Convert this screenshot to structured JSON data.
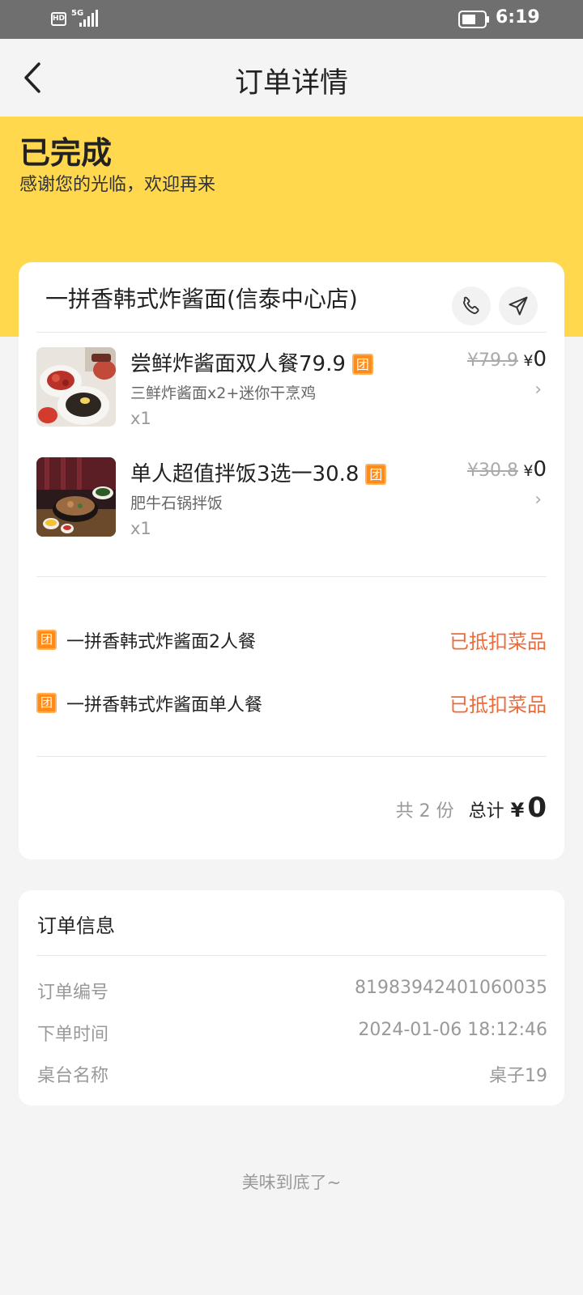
{
  "status_bar": {
    "network_badge": "HD",
    "network_type": "5G",
    "time": "6:19",
    "icons": [
      "hd-icon",
      "signal-icon",
      "battery-icon"
    ]
  },
  "nav": {
    "back_icon": "chevron-left-icon",
    "title": "订单详情"
  },
  "status": {
    "title": "已完成",
    "subtitle": "感谢您的光临，欢迎再来"
  },
  "store": {
    "name": "一拼香韩式炸酱面(信泰中心店)",
    "actions": [
      "phone-icon",
      "navigation-icon"
    ]
  },
  "items": [
    {
      "name": "尝鲜炸酱面双人餐79.9",
      "badge": "团",
      "desc": "三鲜炸酱面x2+迷你干烹鸡",
      "qty": "x1",
      "original_price": "¥79.9",
      "currency": "¥",
      "price": "0"
    },
    {
      "name": "单人超值拌饭3选一30.8",
      "badge": "团",
      "desc": "肥牛石锅拌饭",
      "qty": "x1",
      "original_price": "¥30.8",
      "currency": "¥",
      "price": "0"
    }
  ],
  "vouchers": [
    {
      "badge": "团",
      "label": "一拼香韩式炸酱面2人餐",
      "status": "已抵扣菜品"
    },
    {
      "badge": "团",
      "label": "一拼香韩式炸酱面单人餐",
      "status": "已抵扣菜品"
    }
  ],
  "summary": {
    "count": "共 2 份",
    "total_label": "总计",
    "currency": "¥",
    "total": "0"
  },
  "order_info": {
    "title": "订单信息",
    "rows": [
      {
        "label": "订单编号",
        "value": "81983942401060035"
      },
      {
        "label": "下单时间",
        "value": "2024-01-06 18:12:46"
      },
      {
        "label": "桌台名称",
        "value": "桌子19"
      }
    ]
  },
  "footer": {
    "tip": "美味到底了~"
  },
  "colors": {
    "banner": "#ffd84d",
    "accent_orange": "#ff8b1a",
    "deduct_red": "#ec6b3a",
    "page_bg": "#f4f4f4"
  }
}
